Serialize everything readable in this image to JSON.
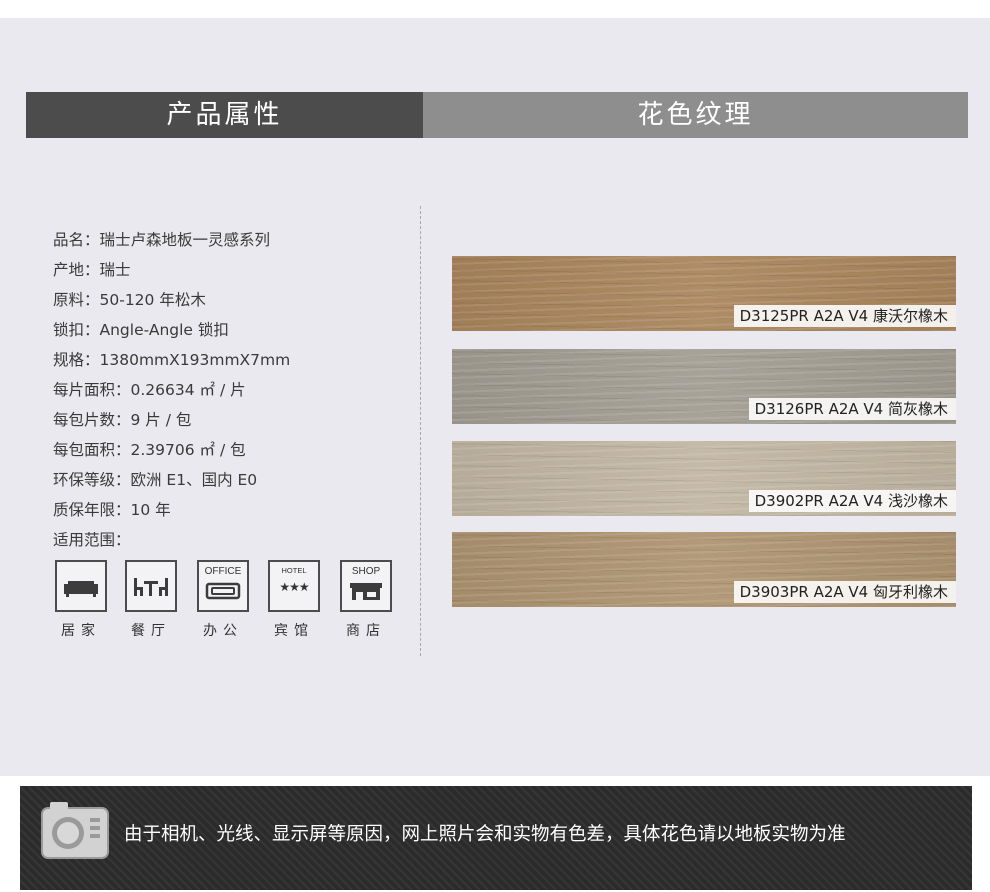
{
  "tabs": {
    "attributes": "产品属性",
    "texture": "花色纹理"
  },
  "specs": [
    "品名：瑞士卢森地板一灵感系列",
    "产地：瑞士",
    "原料：50-120 年松木",
    "锁扣：Angle-Angle 锁扣",
    "规格：1380mmX193mmX7mm",
    "每片面积：0.26634 ㎡ / 片",
    "每包片数：9 片 / 包",
    "每包面积：2.39706 ㎡ / 包",
    "环保等级：欧洲 E1、国内 E0",
    "质保年限：10 年",
    "适用范围："
  ],
  "uses": [
    {
      "icon": "sofa-icon",
      "tag": "",
      "label": "居家"
    },
    {
      "icon": "dining-table-icon",
      "tag": "",
      "label": "餐厅"
    },
    {
      "icon": "office-icon",
      "tag": "OFFICE",
      "label": "办公"
    },
    {
      "icon": "hotel-icon",
      "tag": "HOTEL",
      "stars": "★★★",
      "label": "宾馆"
    },
    {
      "icon": "shop-icon",
      "tag": "SHOP",
      "label": "商店"
    }
  ],
  "swatches": [
    {
      "label": "D3125PR A2A V4 康沃尔橡木",
      "color": "#a9855c"
    },
    {
      "label": "D3126PR A2A V4 简灰橡木",
      "color": "#a29d92"
    },
    {
      "label": "D3902PR A2A V4 浅沙橡木",
      "color": "#c1b6a2"
    },
    {
      "label": "D3903PR A2A V4 匈牙利橡木",
      "color": "#ae9470"
    }
  ],
  "footer": {
    "icon": "camera-icon",
    "notice": "由于相机、光线、显示屏等原因，网上照片会和实物有色差，具体花色请以地板实物为准"
  }
}
